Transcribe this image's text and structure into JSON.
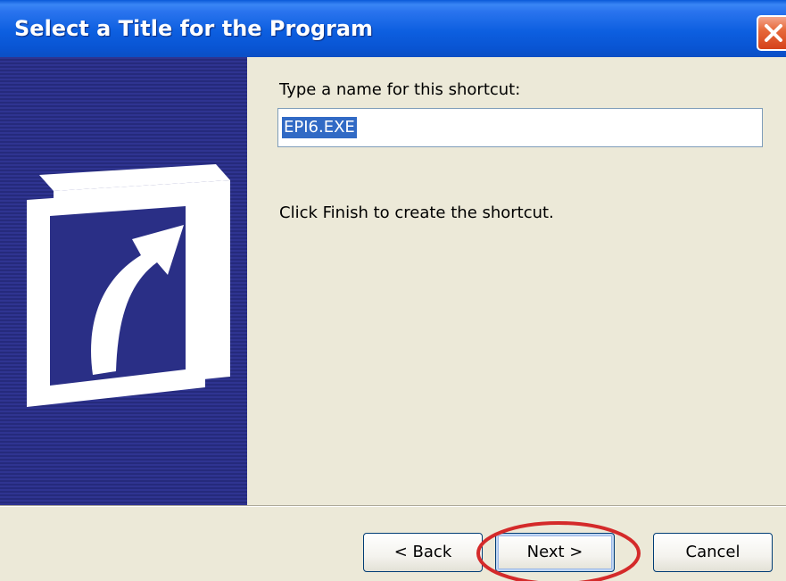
{
  "window": {
    "title": "Select a Title for the Program"
  },
  "content": {
    "prompt_label": "Type a name for this shortcut:",
    "name_input_value": "EPI6.EXE",
    "finish_text": "Click Finish to create the shortcut."
  },
  "buttons": {
    "back_label": "< Back",
    "next_label": "Next >",
    "cancel_label": "Cancel"
  },
  "icons": {
    "close": "close-icon",
    "shortcut": "shortcut-arrow-icon"
  },
  "colors": {
    "title_bar": "#0d5fe0",
    "banner": "#2a2f86",
    "selection": "#316ac5",
    "annotation": "#d42a2a",
    "close_button": "#e76a3c"
  }
}
